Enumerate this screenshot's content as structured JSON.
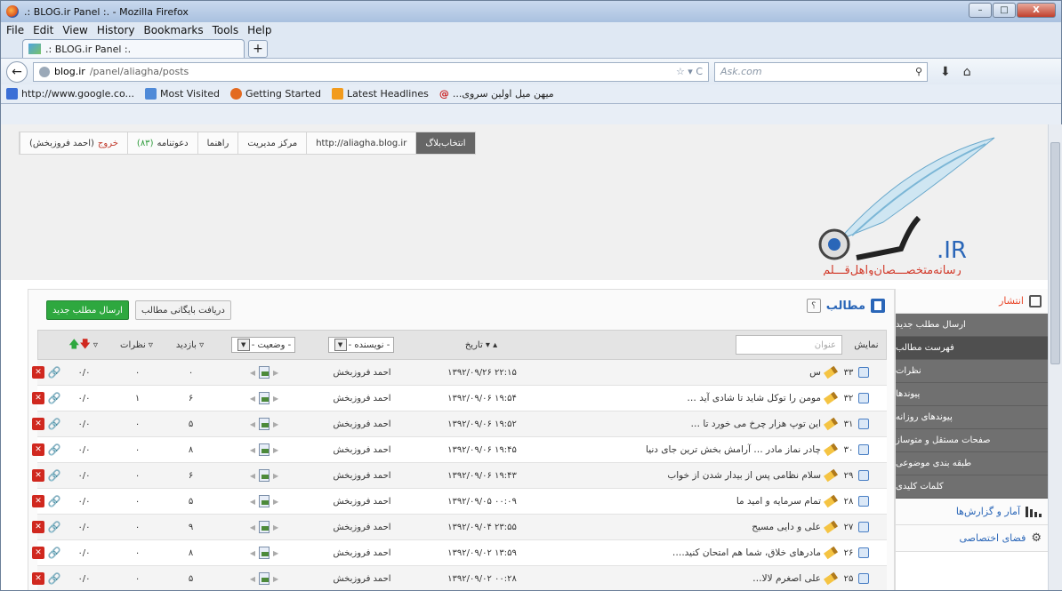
{
  "window": {
    "title": ".: BLOG.ir Panel :. - Mozilla Firefox",
    "buttons": {
      "min": "–",
      "max": "□",
      "close": "X"
    }
  },
  "menu": [
    "File",
    "Edit",
    "View",
    "History",
    "Bookmarks",
    "Tools",
    "Help"
  ],
  "tab": {
    "title": ".: BLOG.ir Panel :.",
    "new": "+"
  },
  "address": {
    "host": "blog.ir",
    "path": "/panel/aliagha/posts",
    "search_placeholder": "Ask.com"
  },
  "bookmarks": [
    {
      "label": "http://www.google.co...",
      "icon": "google-icon",
      "color": "#3b6fd6"
    },
    {
      "label": "Most Visited",
      "icon": "most-visited-icon",
      "color": "#4f8ad8"
    },
    {
      "label": "Getting Started",
      "icon": "firefox-icon",
      "color": "#e36a20"
    },
    {
      "label": "Latest Headlines",
      "icon": "rss-icon",
      "color": "#f29b1d"
    },
    {
      "label": "...میهن میل اولین سروی",
      "icon": "at-icon",
      "color": "#cc2222"
    }
  ],
  "blogbar": {
    "choose": "انتخاب‌بلاگ",
    "url": "http://aliagha.blog.ir",
    "manage": "مرکز مدیریت",
    "help": "راهنما",
    "invite": "دعوتنامه",
    "invite_count": "(۸۳)",
    "exit": "خروج",
    "user": "(احمد فروزبخش)"
  },
  "logo": {
    "text": ".IR",
    "tagline": "رسانه‌متخصـــصان‌واهل‌قـــلم"
  },
  "page": {
    "title": "مطالب",
    "help": "؟",
    "new_post": "ارسال مطلب جدید",
    "archive": "دریافت بایگانی مطالب"
  },
  "sidebar": {
    "publish": "انتشار",
    "items": [
      "ارسال مطلب جدید",
      "فهرست مطالب",
      "نظرات",
      "پیوندها",
      "پیوندهای روزانه",
      "صفحات مستقل و متوساز",
      "طبقه بندی موضوعی",
      "کلمات کلیدی"
    ],
    "stats": "آمار و گزارش‌ها",
    "private": "فضای اختصاصی"
  },
  "table_header": {
    "show": "نمایش",
    "title_placeholder": "عنوان",
    "date": "تاریخ ▾ ▴",
    "author": "- نویسنده -",
    "status": "- وضعیت -",
    "visits": "بازدید ▿",
    "comments": "نظرات ▿",
    "sort_down": "▿"
  },
  "rows": [
    {
      "id": "۳۳",
      "title": "س",
      "date": "۱۳۹۲/۰۹/۲۶ ۲۲:۱۵",
      "author": "احمد فروزبخش",
      "visits": "۰",
      "comments": "۰",
      "rate": "۰/۰",
      "draft": true
    },
    {
      "id": "۳۲",
      "title": "مومن را توکل شاید تا شادی آید …",
      "date": "۱۳۹۲/۰۹/۰۶ ۱۹:۵۴",
      "author": "احمد فروزبخش",
      "visits": "۶",
      "comments": "۱",
      "rate": "۰/۰"
    },
    {
      "id": "۳۱",
      "title": "این توپ هزار چرخ می خورد تا …",
      "date": "۱۳۹۲/۰۹/۰۶ ۱۹:۵۲",
      "author": "احمد فروزبخش",
      "visits": "۵",
      "comments": "۰",
      "rate": "۰/۰"
    },
    {
      "id": "۳۰",
      "title": "چادر نماز مادر … آرامش بخش ترین جای دنیا",
      "date": "۱۳۹۲/۰۹/۰۶ ۱۹:۴۵",
      "author": "احمد فروزبخش",
      "visits": "۸",
      "comments": "۰",
      "rate": "۰/۰"
    },
    {
      "id": "۲۹",
      "title": "سلام نظامی پس از بیدار شدن از خواب",
      "date": "۱۳۹۲/۰۹/۰۶ ۱۹:۴۳",
      "author": "احمد فروزبخش",
      "visits": "۶",
      "comments": "۰",
      "rate": "۰/۰"
    },
    {
      "id": "۲۸",
      "title": "تمام سرمایه و امید ما",
      "date": "۱۳۹۲/۰۹/۰۵ ۰۰:۰۹",
      "author": "احمد فروزبخش",
      "visits": "۵",
      "comments": "۰",
      "rate": "۰/۰"
    },
    {
      "id": "۲۷",
      "title": "علی و دایی مسیح",
      "date": "۱۳۹۲/۰۹/۰۴ ۲۳:۵۵",
      "author": "احمد فروزبخش",
      "visits": "۹",
      "comments": "۰",
      "rate": "۰/۰"
    },
    {
      "id": "۲۶",
      "title": "مادرهای خلاق، شما هم امتحان کنید.…",
      "date": "۱۳۹۲/۰۹/۰۲ ۱۳:۵۹",
      "author": "احمد فروزبخش",
      "visits": "۸",
      "comments": "۰",
      "rate": "۰/۰"
    },
    {
      "id": "۲۵",
      "title": "علی اصغرم لالا…",
      "date": "۱۳۹۲/۰۹/۰۲ ۰۰:۲۸",
      "author": "احمد فروزبخش",
      "visits": "۵",
      "comments": "۰",
      "rate": "۰/۰"
    }
  ]
}
